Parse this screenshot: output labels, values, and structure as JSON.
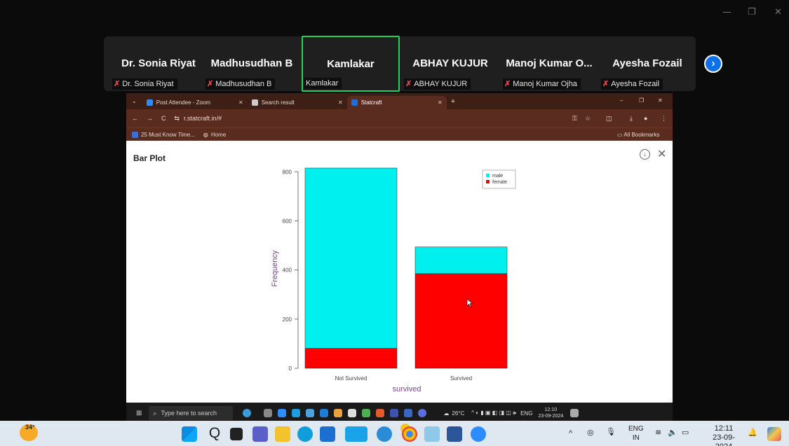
{
  "zoom": {
    "window_controls": {
      "minimize": "—",
      "restore": "❐",
      "close": "✕"
    },
    "participants": [
      {
        "name": "Dr. Sonia Riyat",
        "label": "Dr. Sonia Riyat",
        "muted": true,
        "active": false
      },
      {
        "name": "Madhusudhan B",
        "label": "Madhusudhan B",
        "muted": true,
        "active": false
      },
      {
        "name": "Kamlakar",
        "label": "Kamlakar",
        "muted": false,
        "active": true
      },
      {
        "name": "ABHAY KUJUR",
        "label": "ABHAY KUJUR",
        "muted": true,
        "active": false
      },
      {
        "name": "Manoj Kumar O...",
        "label": "Manoj Kumar Ojha",
        "muted": true,
        "active": false
      },
      {
        "name": "Ayesha Fozail",
        "label": "Ayesha Fozail",
        "muted": true,
        "active": false
      }
    ],
    "next_icon": "chevron-right-icon"
  },
  "browser": {
    "tabs": [
      {
        "title": "Post Attendee - Zoom",
        "favicon_color": "#2d8cff"
      },
      {
        "title": "Search result",
        "favicon_color": "#cccccc"
      },
      {
        "title": "Statcraft",
        "favicon_color": "#1e6fd9"
      }
    ],
    "new_tab": "+",
    "url": "r.statcraft.in/#",
    "bookmarks": [
      "25 Must Know Time...",
      "Home"
    ],
    "all_bookmarks": "All Bookmarks",
    "window_controls": {
      "minimize": "–",
      "restore": "❐",
      "close": "✕"
    }
  },
  "panel": {
    "title": "Bar Plot",
    "download_icon": "download-icon",
    "close_icon": "close-icon"
  },
  "chart_data": {
    "type": "bar",
    "stacked": true,
    "categories": [
      "Not Survived",
      "Survived"
    ],
    "series": [
      {
        "name": "female",
        "values": [
          81,
          385
        ],
        "color": "#ff0000"
      },
      {
        "name": "male",
        "values": [
          734,
          109
        ],
        "color": "#00f0f0"
      }
    ],
    "xlabel": "survived",
    "ylabel": "Frequency",
    "ylim": [
      0,
      800
    ],
    "yticks": [
      0,
      200,
      400,
      600,
      800
    ],
    "legend": {
      "placement": "top-right",
      "order": [
        "male",
        "female"
      ]
    }
  },
  "inner_taskbar": {
    "search_placeholder": "Type here to search",
    "weather": "26°C",
    "lang": "ENG",
    "time": "12:10",
    "date": "23-09-2024"
  },
  "taskbar": {
    "weather_temp": "34°",
    "lang_line1": "ENG",
    "lang_line2": "IN",
    "time": "12:11",
    "date": "23-09-2024"
  }
}
